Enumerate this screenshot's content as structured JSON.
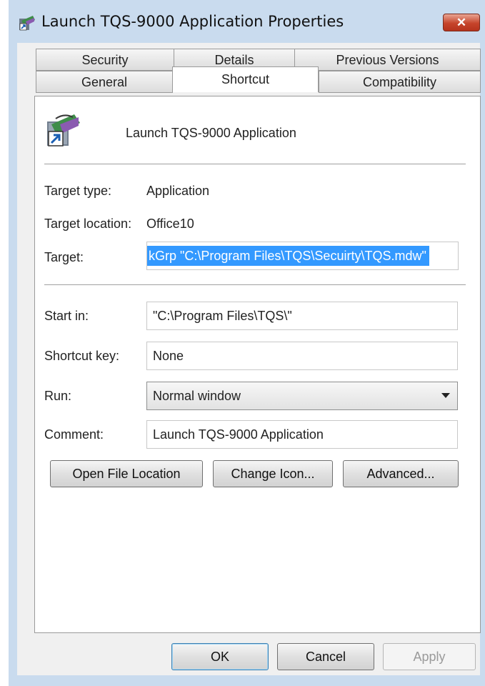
{
  "window": {
    "title": "Launch TQS-9000 Application Properties",
    "close_label": "✕"
  },
  "tabs": {
    "row1": [
      "Security",
      "Details",
      "Previous Versions"
    ],
    "row2": [
      "General",
      "Shortcut",
      "Compatibility"
    ],
    "active": "Shortcut"
  },
  "shortcut": {
    "name": "Launch TQS-9000 Application",
    "target_type_label": "Target type:",
    "target_type_value": "Application",
    "target_location_label": "Target location:",
    "target_location_value": "Office10",
    "target_label": "Target:",
    "target_value": "kGrp \"C:\\Program Files\\TQS\\Secuirty\\TQS.mdw\"",
    "start_in_label": "Start in:",
    "start_in_value": "\"C:\\Program Files\\TQS\\\"",
    "shortcut_key_label": "Shortcut key:",
    "shortcut_key_value": "None",
    "run_label": "Run:",
    "run_value": "Normal window",
    "comment_label": "Comment:",
    "comment_value": "Launch TQS-9000 Application"
  },
  "buttons": {
    "open_file_location": "Open File Location",
    "change_icon": "Change Icon...",
    "advanced": "Advanced...",
    "ok": "OK",
    "cancel": "Cancel",
    "apply": "Apply"
  },
  "colors": {
    "selection": "#3399ff",
    "frame": "#c9dbee",
    "close_button": "#c6442b"
  },
  "icons": [
    "shortcut-app-icon",
    "close-icon",
    "dropdown-arrow-icon"
  ]
}
